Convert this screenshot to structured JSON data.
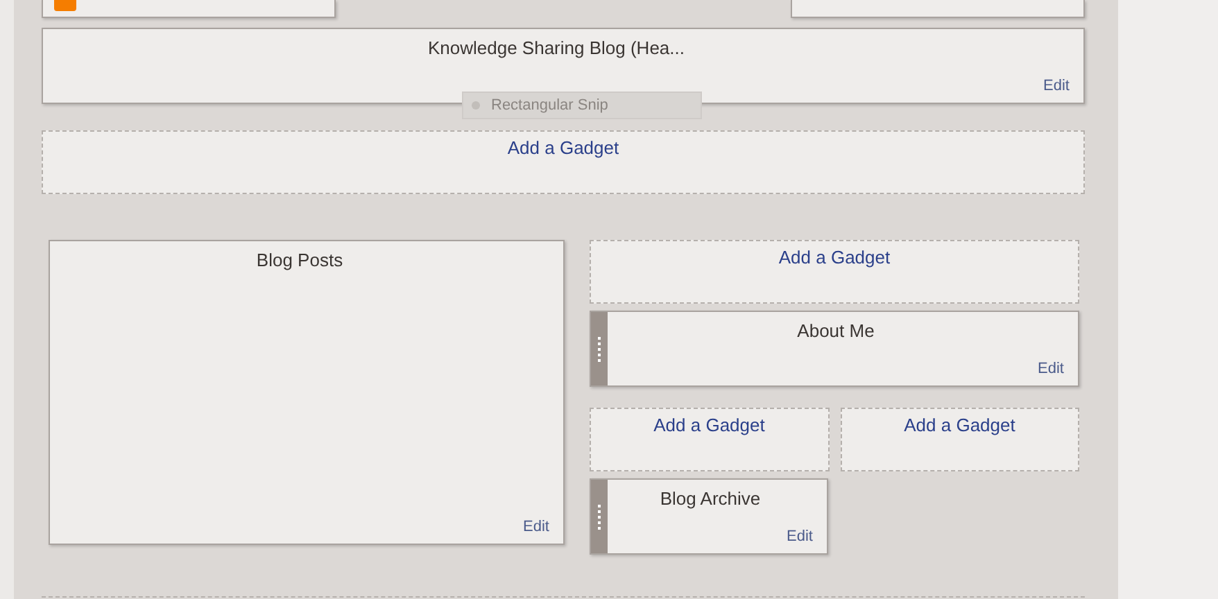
{
  "header_widget": {
    "title": "Knowledge Sharing Blog (Hea...",
    "edit": "Edit"
  },
  "snip_tooltip": "Rectangular Snip",
  "header_add_gadget": "Add a Gadget",
  "main_column": {
    "title": "Blog Posts",
    "edit": "Edit"
  },
  "sidebar": [
    {
      "kind": "add",
      "label": "Add a Gadget"
    },
    {
      "kind": "widget",
      "title": "About Me",
      "edit": "Edit"
    }
  ],
  "sidebar_pair": [
    {
      "label": "Add a Gadget"
    },
    {
      "label": "Add a Gadget"
    }
  ],
  "sidebar_bottom": {
    "title": "Blog Archive",
    "edit": "Edit"
  }
}
